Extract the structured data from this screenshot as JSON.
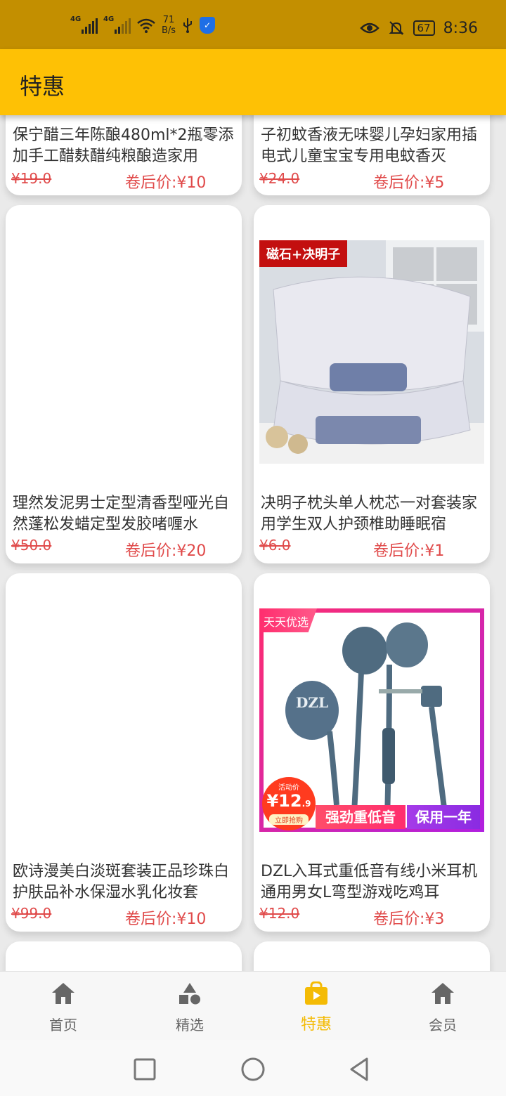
{
  "status_bar": {
    "net1": "4G",
    "net2": "4G",
    "speed_value": "71",
    "speed_unit": "B/s",
    "battery": "67",
    "time": "8:36"
  },
  "header": {
    "title": "特惠"
  },
  "products": [
    {
      "title": "保宁醋三年陈酿480ml*2瓶零添加手工醋麸醋纯粮酿造家用",
      "original_price": "¥19.0",
      "coupon_price": "卷后价:¥10"
    },
    {
      "title": "子初蚊香液无味婴儿孕妇家用插电式儿童宝宝专用电蚊香灭",
      "original_price": "¥24.0",
      "coupon_price": "卷后价:¥5"
    },
    {
      "title": "理然发泥男士定型清香型哑光自然蓬松发蜡定型发胶啫喱水",
      "original_price": "¥50.0",
      "coupon_price": "卷后价:¥20"
    },
    {
      "title": "决明子枕头单人枕芯一对套装家用学生双人护颈椎助睡眠宿",
      "original_price": "¥6.0",
      "coupon_price": "卷后价:¥1",
      "image_badge": "磁石+决明子"
    },
    {
      "title": "欧诗漫美白淡斑套装正品珍珠白护肤品补水保湿水乳化妆套",
      "original_price": "¥99.0",
      "coupon_price": "卷后价:¥10"
    },
    {
      "title": "DZL入耳式重低音有线小米耳机通用男女L弯型游戏吃鸡耳",
      "original_price": "¥12.0",
      "coupon_price": "卷后价:¥3",
      "image_badge": "天天优选",
      "image_brand": "DZL",
      "image_promo_small": "活动价",
      "image_promo_price": "¥12",
      "image_promo_cents": ".9",
      "image_promo_btn": "立即抢购",
      "image_slogan1": "强劲重低音",
      "image_slogan2": "保用一年"
    }
  ],
  "bottom_nav": [
    {
      "label": "首页",
      "icon": "home-icon"
    },
    {
      "label": "精选",
      "icon": "shapes-icon"
    },
    {
      "label": "特惠",
      "icon": "shopping-bag-icon",
      "active": true
    },
    {
      "label": "会员",
      "icon": "home-icon"
    }
  ],
  "colors": {
    "header": "#fec105",
    "status_bar": "#c38f00",
    "price": "#e04a4a",
    "active_nav": "#f4bb05"
  }
}
